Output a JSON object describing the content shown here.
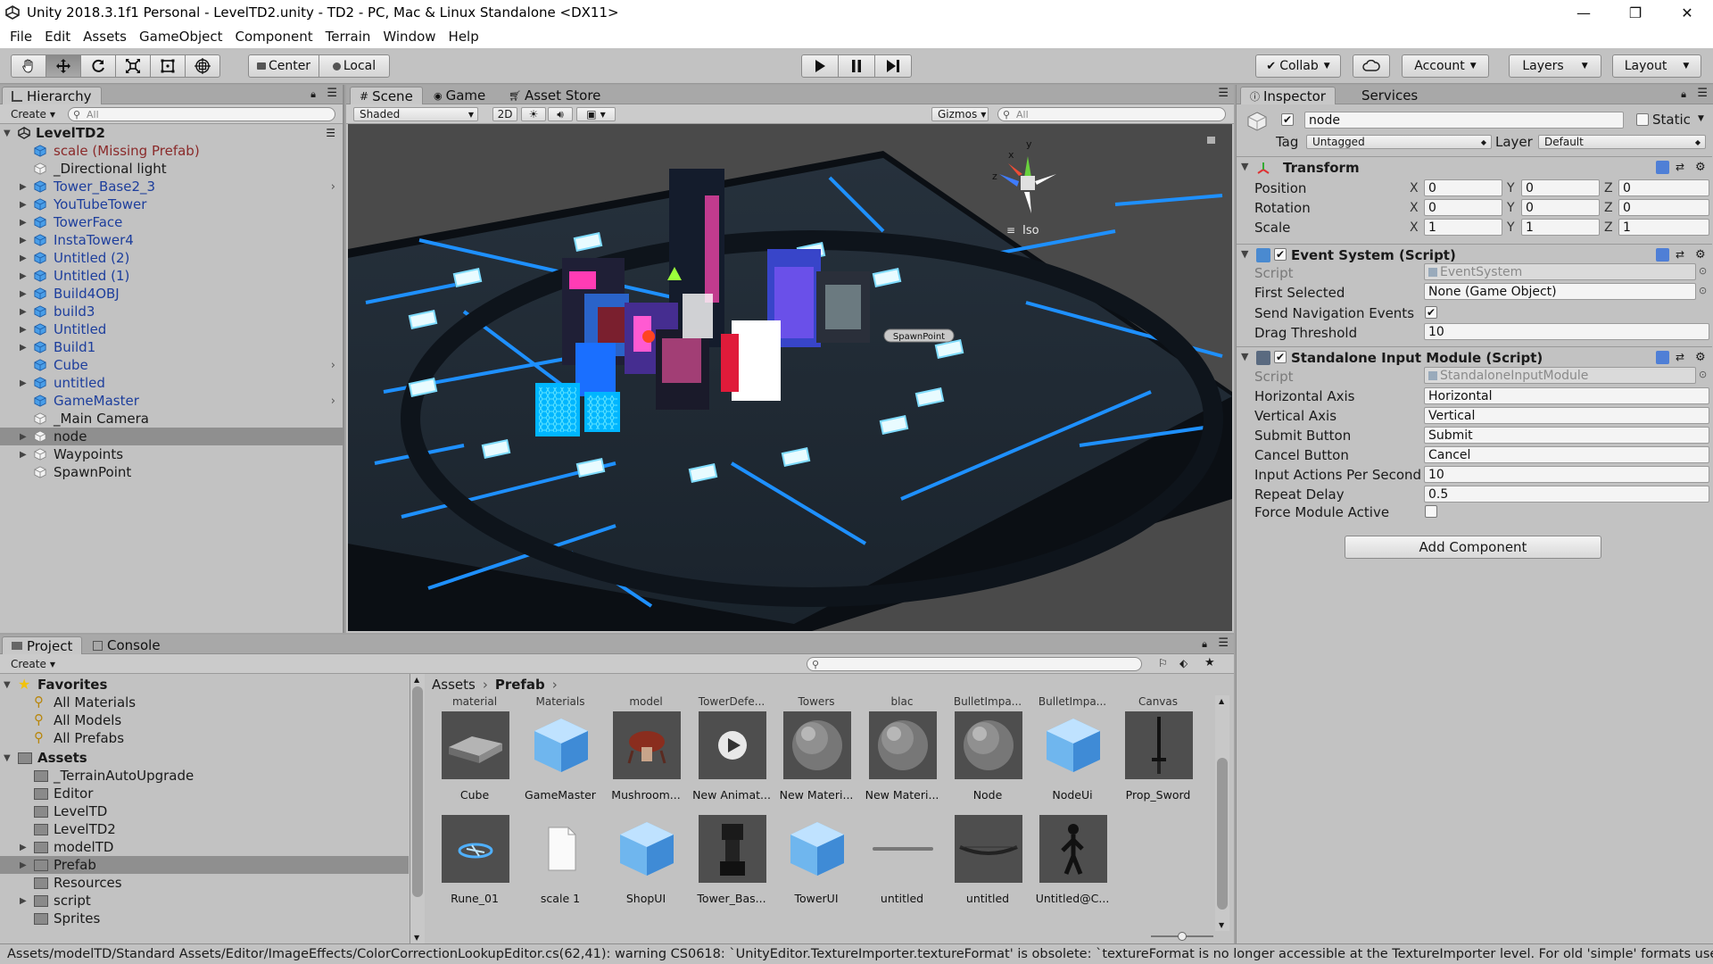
{
  "window": {
    "title": "Unity 2018.3.1f1 Personal - LevelTD2.unity - TD2 - PC, Mac & Linux Standalone <DX11>",
    "minimize": "—",
    "maximize": "❐",
    "close": "✕"
  },
  "menu": [
    "File",
    "Edit",
    "Assets",
    "GameObject",
    "Component",
    "Terrain",
    "Window",
    "Help"
  ],
  "toolbar": {
    "pivot": "Center",
    "space": "Local",
    "collab": "Collab",
    "account": "Account",
    "layers": "Layers",
    "layout": "Layout"
  },
  "hierarchy": {
    "tab": "Hierarchy",
    "create": "Create",
    "search_placeholder": "All",
    "scene_name": "LevelTD2",
    "items": [
      {
        "label": "scale (Missing Prefab)",
        "kind": "missing",
        "expand": false
      },
      {
        "label": "_Directional light",
        "kind": "object",
        "expand": false
      },
      {
        "label": "Tower_Base2_3",
        "kind": "prefab",
        "expand": true,
        "chevron": true
      },
      {
        "label": "YouTubeTower",
        "kind": "prefab",
        "expand": true
      },
      {
        "label": "TowerFace",
        "kind": "prefab",
        "expand": true
      },
      {
        "label": "InstaTower4",
        "kind": "prefab",
        "expand": true
      },
      {
        "label": "Untitled (2)",
        "kind": "prefab",
        "expand": true
      },
      {
        "label": "Untitled (1)",
        "kind": "prefab",
        "expand": true
      },
      {
        "label": "Build4OBJ",
        "kind": "prefab",
        "expand": true
      },
      {
        "label": "build3",
        "kind": "prefab",
        "expand": true
      },
      {
        "label": "Untitled",
        "kind": "prefab",
        "expand": true
      },
      {
        "label": "Build1",
        "kind": "prefab",
        "expand": true
      },
      {
        "label": "Cube",
        "kind": "prefab",
        "expand": false,
        "chevron": true
      },
      {
        "label": "untitled",
        "kind": "prefab",
        "expand": true
      },
      {
        "label": "GameMaster",
        "kind": "prefab",
        "expand": false,
        "chevron": true
      },
      {
        "label": "_Main Camera",
        "kind": "object",
        "expand": false
      },
      {
        "label": "node",
        "kind": "object",
        "expand": true,
        "selected": true
      },
      {
        "label": "Waypoints",
        "kind": "object",
        "expand": true
      },
      {
        "label": "SpawnPoint",
        "kind": "object",
        "expand": false
      }
    ]
  },
  "scene": {
    "tabs": [
      "Scene",
      "Game",
      "Asset Store"
    ],
    "shading": "Shaded",
    "mode2d": "2D",
    "gizmos": "Gizmos",
    "search_placeholder": "All",
    "iso": "Iso",
    "spawn_label": "SpawnPoint",
    "axis_x": "x",
    "axis_y": "y",
    "axis_z": "z"
  },
  "inspector": {
    "tabs": [
      "Inspector",
      "Services"
    ],
    "object_name": "node",
    "static": "Static",
    "tag_label": "Tag",
    "tag": "Untagged",
    "layer_label": "Layer",
    "layer": "Default",
    "transform": {
      "title": "Transform",
      "rows": [
        {
          "label": "Position",
          "x": "0",
          "y": "0",
          "z": "0"
        },
        {
          "label": "Rotation",
          "x": "0",
          "y": "0",
          "z": "0"
        },
        {
          "label": "Scale",
          "x": "1",
          "y": "1",
          "z": "1"
        }
      ]
    },
    "event_system": {
      "title": "Event System (Script)",
      "script_label": "Script",
      "script": "EventSystem",
      "first_selected_label": "First Selected",
      "first_selected": "None (Game Object)",
      "send_nav_label": "Send Navigation Events",
      "send_nav": true,
      "drag_label": "Drag Threshold",
      "drag": "10"
    },
    "input_module": {
      "title": "Standalone Input Module (Script)",
      "script_label": "Script",
      "script": "StandaloneInputModule",
      "rows": [
        {
          "label": "Horizontal Axis",
          "value": "Horizontal"
        },
        {
          "label": "Vertical Axis",
          "value": "Vertical"
        },
        {
          "label": "Submit Button",
          "value": "Submit"
        },
        {
          "label": "Cancel Button",
          "value": "Cancel"
        },
        {
          "label": "Input Actions Per Second",
          "value": "10"
        },
        {
          "label": "Repeat Delay",
          "value": "0.5"
        }
      ],
      "force_label": "Force Module Active",
      "force": false
    },
    "add_component": "Add Component"
  },
  "project": {
    "tabs": [
      "Project",
      "Console"
    ],
    "create": "Create",
    "favorites": {
      "label": "Favorites",
      "items": [
        "All Materials",
        "All Models",
        "All Prefabs"
      ]
    },
    "assets": {
      "label": "Assets",
      "items": [
        {
          "label": "_TerrainAutoUpgrade",
          "expand": false
        },
        {
          "label": "Editor",
          "expand": false
        },
        {
          "label": "LevelTD",
          "expand": false
        },
        {
          "label": "LevelTD2",
          "expand": false
        },
        {
          "label": "modelTD",
          "expand": true
        },
        {
          "label": "Prefab",
          "expand": true,
          "selected": true
        },
        {
          "label": "Resources",
          "expand": false
        },
        {
          "label": "script",
          "expand": true
        },
        {
          "label": "Sprites",
          "expand": false
        }
      ]
    },
    "breadcrumb": [
      "Assets",
      "Prefab"
    ],
    "cut_row": [
      "material",
      "Materials",
      "model",
      "TowerDefe...",
      "Towers",
      "blac",
      "BulletImpa...",
      "BulletImpa...",
      "Canvas"
    ],
    "row1": [
      {
        "name": "Cube",
        "thumb": "slab"
      },
      {
        "name": "GameMaster",
        "thumb": "bluecube"
      },
      {
        "name": "Mushroom...",
        "thumb": "mushroom"
      },
      {
        "name": "New Animat...",
        "thumb": "anim"
      },
      {
        "name": "New Materi...",
        "thumb": "sphere"
      },
      {
        "name": "New Materi...",
        "thumb": "sphere"
      },
      {
        "name": "Node",
        "thumb": "sphere"
      },
      {
        "name": "NodeUi",
        "thumb": "bluecube"
      },
      {
        "name": "Prop_Sword",
        "thumb": "sword"
      }
    ],
    "row2": [
      {
        "name": "Rune_01",
        "thumb": "rune"
      },
      {
        "name": "scale 1",
        "thumb": "file"
      },
      {
        "name": "ShopUI",
        "thumb": "bluecube"
      },
      {
        "name": "Tower_Bas...",
        "thumb": "tower"
      },
      {
        "name": "TowerUI",
        "thumb": "bluecube"
      },
      {
        "name": "untitled",
        "thumb": "line"
      },
      {
        "name": "untitled",
        "thumb": "bow"
      },
      {
        "name": "Untitled@C...",
        "thumb": "figure"
      }
    ]
  },
  "status": {
    "message": "Assets/modelTD/Standard Assets/Editor/ImageEffects/ColorCorrectionLookupEditor.cs(62,41): warning CS0618: `UnityEditor.TextureImporter.textureFormat' is obsolete: `textureFormat is no longer accessible at the TextureImporter level. For old 'simple' formats use"
  },
  "colors": {
    "panel": "#c2c2c2",
    "prefab_text": "#1d3e9c",
    "missing_text": "#8a2a2a",
    "selected_row": "#8f8f8f",
    "neon_blue": "#1e90ff",
    "scene_floor": "#1b2530"
  }
}
